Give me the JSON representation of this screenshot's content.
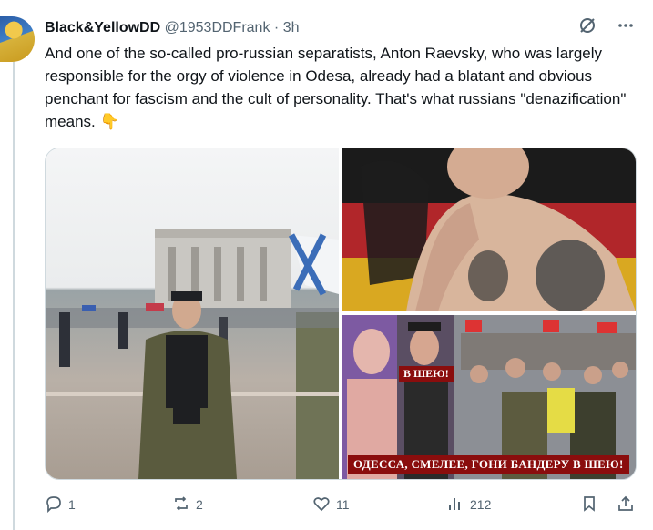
{
  "author": {
    "display_name": "Black&YellowDD",
    "handle": "@1953DDFrank",
    "separator": "·",
    "time": "3h"
  },
  "tweet": {
    "text": "And one of the so-called pro-russian separatists, Anton Raevsky, who was largely responsible for the orgy of violence in Odesa, already had a blatant and obvious penchant for fascism and the cult of personality. That's what russians \"denazification\" means. 👇"
  },
  "media": {
    "bottom_right_caption": "ОДЕССА, СМЕЛЕЕ, ГОНИ БАНДЕРУ В ШЕЮ!",
    "bottom_right_overlay": "В ШЕЮ!"
  },
  "actions": {
    "replies": "1",
    "reposts": "2",
    "likes": "11",
    "views": "212"
  },
  "icons": [
    "grok-icon",
    "more-icon",
    "reply-icon",
    "repost-icon",
    "like-icon",
    "views-icon",
    "bookmark-icon",
    "share-icon"
  ]
}
